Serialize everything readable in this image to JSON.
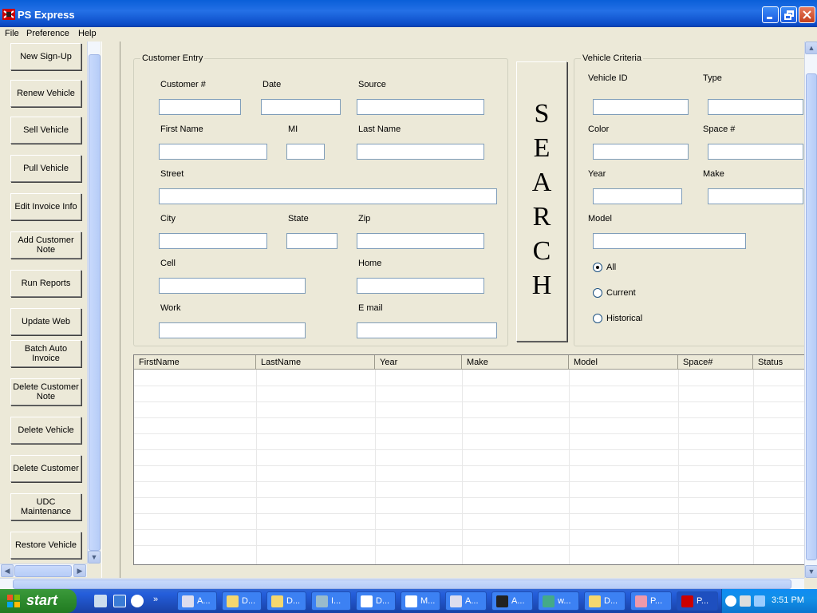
{
  "window": {
    "title": "PS Express"
  },
  "menu": [
    "File",
    "Preference",
    "Help"
  ],
  "sidebar": {
    "buttons": [
      "New Sign-Up",
      "Renew Vehicle",
      "Sell Vehicle",
      "Pull Vehicle",
      "Edit Invoice Info",
      "Add Customer Note",
      "Run Reports",
      "Update Web",
      "Batch Auto Invoice",
      "Delete Customer Note",
      "Delete Vehicle",
      "Delete Customer",
      "UDC Maintenance",
      "Restore Vehicle"
    ]
  },
  "customer_entry": {
    "title": "Customer Entry",
    "labels": {
      "customer_no": "Customer #",
      "date": "Date",
      "source": "Source",
      "first_name": "First Name",
      "mi": "MI",
      "last_name": "Last Name",
      "street": "Street",
      "city": "City",
      "state": "State",
      "zip": "Zip",
      "cell": "Cell",
      "home": "Home",
      "work": "Work",
      "email": "E mail"
    }
  },
  "search_button": {
    "letters": [
      "S",
      "E",
      "A",
      "R",
      "C",
      "H"
    ]
  },
  "vehicle_criteria": {
    "title": "Vehicle Criteria",
    "labels": {
      "vehicle_id": "Vehicle ID",
      "type": "Type",
      "color": "Color",
      "space": "Space #",
      "year": "Year",
      "make": "Make",
      "model": "Model"
    },
    "radios": [
      {
        "label": "All",
        "selected": true
      },
      {
        "label": "Current",
        "selected": false
      },
      {
        "label": "Historical",
        "selected": false
      }
    ]
  },
  "results_grid": {
    "columns": [
      "FirstName",
      "LastName",
      "Year",
      "Make",
      "Model",
      "Space#",
      "Status"
    ]
  },
  "taskbar": {
    "start_label": "start",
    "tasks": [
      "A...",
      "D...",
      "D...",
      "I...",
      "D...",
      "M...",
      "A...",
      "A...",
      "w...",
      "D...",
      "P...",
      "P..."
    ],
    "clock": "3:51 PM"
  },
  "colors": {
    "titlebar": "#0a5fd8",
    "face": "#ece9d8",
    "taskbar": "#245edb",
    "start": "#2d8a2d"
  }
}
